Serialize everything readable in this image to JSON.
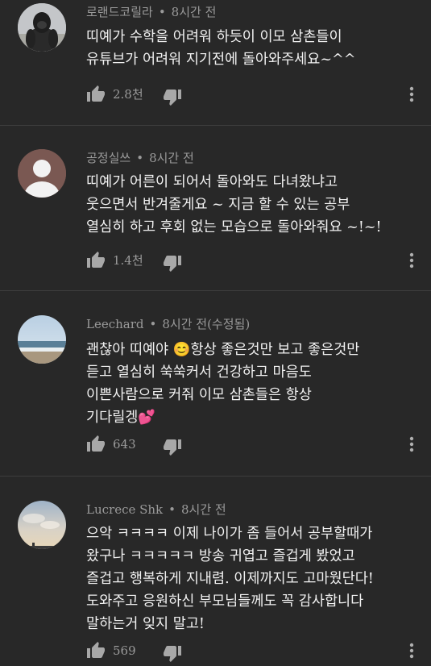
{
  "comments": [
    {
      "author": "로랜드코릴라",
      "time": "8시간 전",
      "text": "띠예가 수학을 어려워 하듯이 이모 삼촌들이\n유튜브가 어려워 지기전에 돌아와주세요~^^",
      "likes": "2.8천",
      "avatar": "gorilla"
    },
    {
      "author": "공정실쓰",
      "time": "8시간 전",
      "text": "띠예가 어른이 되어서 돌아와도 다녀왔냐고\n웃으면서 반겨줄게요 ~ 지금 할 수 있는 공부\n열심히 하고 후회 없는 모습으로 돌아와줘요 ~!~!",
      "likes": "1.4천",
      "avatar": "default-person"
    },
    {
      "author": "Leechard",
      "time": "8시간 전(수정됨)",
      "text": "괜찮아 띠예야 😊항상 좋은것만 보고 좋은것만\n듣고 열심히 쑥쑥커서 건강하고 마음도\n이쁜사람으로 커줘 이모 삼촌들은 항상\n기다릴겡💕",
      "likes": "643",
      "avatar": "beach"
    },
    {
      "author": "Lucrece Shk",
      "time": "8시간 전",
      "text": "으악 ㅋㅋㅋㅋ 이제 나이가 좀 들어서 공부할때가\n왔구나 ㅋㅋㅋㅋㅋ 방송 귀엽고 즐겁게 봤었고\n즐겁고 행복하게 지내렴. 이제까지도 고마웠단다!\n도와주고 응원하신 부모님들께도 꼭 감사합니다\n말하는거 잊지 말고!",
      "likes": "569",
      "avatar": "sky"
    }
  ],
  "colors": {
    "background": "#282828",
    "text": "#f1f1f1",
    "meta": "#9a9a9a",
    "divider": "#3d3d3d"
  }
}
